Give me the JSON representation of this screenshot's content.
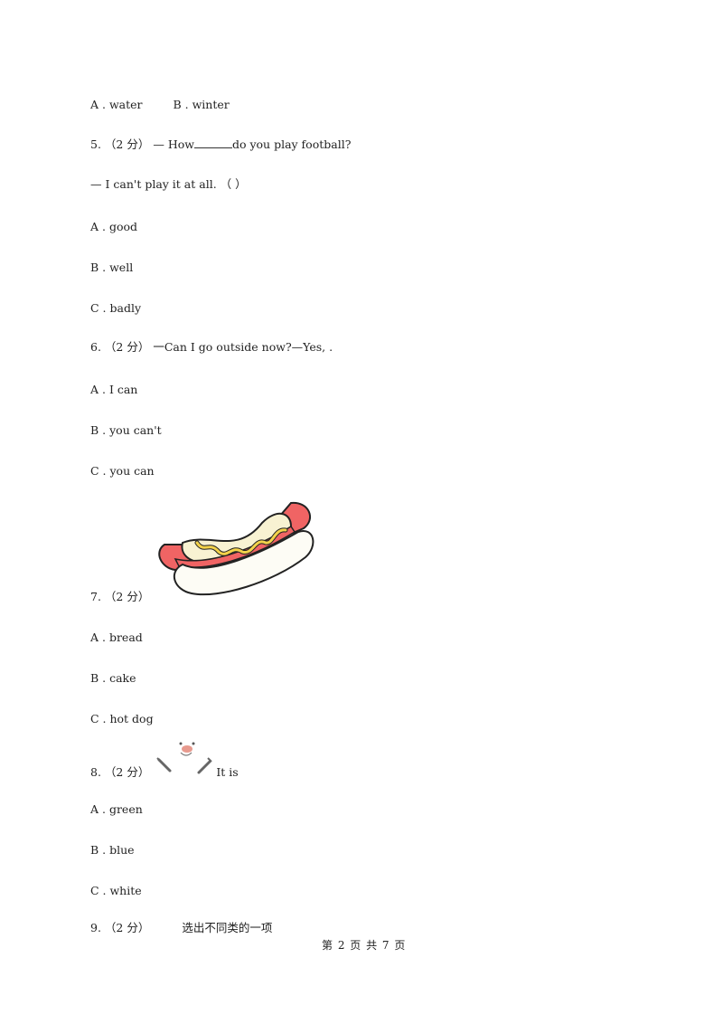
{
  "q4_options": {
    "a": "A . water",
    "b": "B . winter"
  },
  "q5": {
    "number": "5.",
    "score": "（2 分）",
    "stem_before": "— How",
    "stem_after": "do you play football?",
    "line2": "— I can't play it at all. （     ）",
    "options": [
      "A . good",
      "B . well",
      "C . badly"
    ]
  },
  "q6": {
    "number": "6.",
    "score": "（2 分）",
    "stem": "一Can I go outside now?—Yes,        .",
    "options": [
      "A . I can",
      "B . you can't",
      "C . you can"
    ]
  },
  "q7": {
    "number": "7.",
    "score": "（2 分）",
    "image": "hot-dog-illustration",
    "options": [
      "A . bread",
      "B . cake",
      "C . hot dog"
    ]
  },
  "q8": {
    "number": "8.",
    "score": "（2 分）",
    "image": "snowman-illustration",
    "stem": "It is",
    "options": [
      "A . green",
      "B . blue",
      "C . white"
    ]
  },
  "q9": {
    "number": "9.",
    "score": "（2 分）",
    "stem": "选出不同类的一项"
  },
  "footer": {
    "page_label": "第 2 页 共 7 页"
  }
}
